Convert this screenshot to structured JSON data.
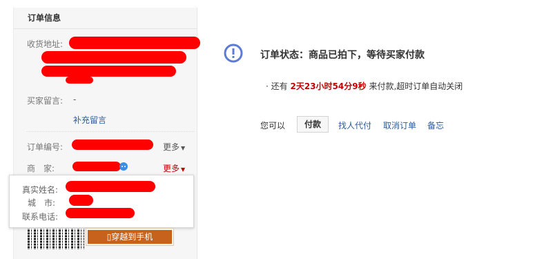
{
  "order_info": {
    "title": "订单信息",
    "address_label": "收货地址:",
    "message_label": "买家留言:",
    "message_value": "-",
    "add_message_link": "补充留言",
    "order_no_label": "订单编号:",
    "order_more": "更多",
    "seller_label": "商　家:",
    "seller_more": "更多"
  },
  "seller_popup": {
    "name_label": "真实姓名:",
    "city_label": "城　市:",
    "phone_label": "联系电话:"
  },
  "mobile": {
    "button_label": "穿越到手机"
  },
  "status": {
    "title": "订单状态：商品已拍下，等待买家付款",
    "bullet": "·",
    "remaining_prefix": "还有",
    "remaining_time": "2天23小时54分9秒",
    "remaining_suffix": "来付款,超时订单自动关闭"
  },
  "actions": {
    "intro": "您可以",
    "pay": "付款",
    "proxy_pay": "找人代付",
    "cancel": "取消订单",
    "memo": "备忘"
  },
  "colors": {
    "accent_red": "#c40000",
    "link_blue": "#2d5c9a",
    "status_icon": "#5b7bd5",
    "mobile_button": "#c7621d"
  }
}
